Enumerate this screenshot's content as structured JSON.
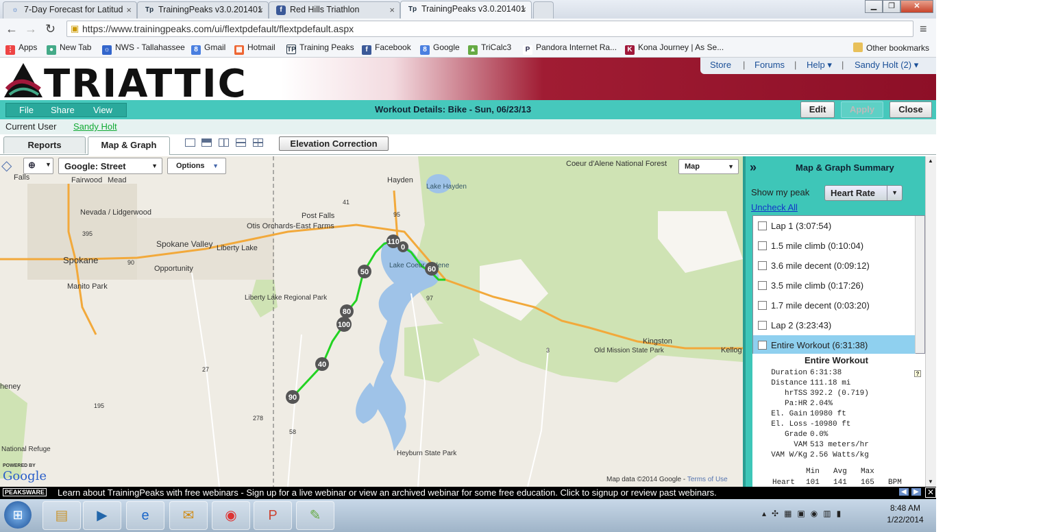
{
  "browser": {
    "tabs": [
      {
        "label": "7-Day Forecast for Latitud",
        "icon": "weather-icon"
      },
      {
        "label": "TrainingPeaks v3.0.201401",
        "icon": "trainingpeaks-icon"
      },
      {
        "label": "Red Hills Triathlon",
        "icon": "facebook-icon"
      },
      {
        "label": "TrainingPeaks v3.0.201401",
        "icon": "trainingpeaks-icon"
      }
    ],
    "url": "https://www.trainingpeaks.com/ui/flextpdefault/flextpdefault.aspx",
    "bookmarks": [
      "Apps",
      "New Tab",
      "NWS - Tallahassee",
      "Gmail",
      "Hotmail",
      "Training Peaks",
      "Facebook",
      "Google",
      "TriCalc3",
      "Pandora Internet Ra...",
      "Kona Journey | As Se...",
      "Other bookmarks"
    ]
  },
  "header": {
    "logo": "TRIATTIC",
    "links": [
      "Store",
      "Forums",
      "Help ▾",
      "Sandy Holt  (2) ▾"
    ]
  },
  "toolbar": {
    "menu": [
      "File",
      "Share",
      "View"
    ],
    "title": "Workout Details: Bike - Sun, 06/23/13",
    "edit": "Edit",
    "apply": "Apply",
    "close": "Close"
  },
  "user": {
    "label": "Current User",
    "name": "Sandy Holt"
  },
  "views": {
    "reports": "Reports",
    "map_graph": "Map & Graph",
    "elevation": "Elevation Correction"
  },
  "map": {
    "source": "Google: Street",
    "options": "Options",
    "type": "Map",
    "labels": [
      "Falls",
      "Fairwood",
      "Mead",
      "Hayden",
      "Lake Hayden",
      "Coeur d'Alene National Forest",
      "Nevada / Lidgerwood",
      "Otis Orchards-East Farms",
      "Post Falls",
      "Spokane Valley",
      "Liberty Lake",
      "Spokane",
      "Opportunity",
      "Manito Park",
      "Lake Coeur d'Alene",
      "Liberty Lake Regional Park",
      "Kingston",
      "Old Mission State Park",
      "Kellog",
      "heney",
      "National Refuge",
      "Heyburn State Park"
    ],
    "routes": [
      "395",
      "90",
      "41",
      "95",
      "27",
      "97",
      "3",
      "195",
      "278",
      "58"
    ],
    "markers": [
      "110",
      "0",
      "60",
      "50",
      "80",
      "100",
      "40",
      "90"
    ],
    "attribution": "Map data ©2014  Google - ",
    "terms": "Terms of Use",
    "powered": "POWERED BY",
    "google": "Google"
  },
  "panel": {
    "title": "Map & Graph Summary",
    "peak_label": "Show my peak",
    "peak_value": "Heart Rate",
    "uncheck": "Uncheck All",
    "laps": [
      "Lap 1 (3:07:54)",
      "1.5 mile climb (0:10:04)",
      "3.6 mile decent (0:09:12)",
      "3.5 mile climb (0:17:26)",
      "1.7 mile decent (0:03:20)",
      "Lap 2 (3:23:43)",
      "Entire Workout (6:31:38)"
    ],
    "summary_title": "Entire Workout",
    "stats": [
      {
        "k": "Duration",
        "v": "6:31:38"
      },
      {
        "k": "Distance",
        "v": "111.18 mi"
      },
      {
        "k": "hrTSS",
        "v": "392.2 (0.719)"
      },
      {
        "k": "Pa:HR",
        "v": "2.04%"
      },
      {
        "k": "El. Gain",
        "v": "10980 ft"
      },
      {
        "k": "El. Loss",
        "v": "-10980 ft"
      },
      {
        "k": "Grade",
        "v": "0.0%"
      },
      {
        "k": "VAM",
        "v": "513 meters/hr"
      },
      {
        "k": "VAM W/Kg",
        "v": "2.56 Watts/kg"
      }
    ],
    "cols": [
      "Min",
      "Avg",
      "Max"
    ],
    "hr_row": {
      "k": "Heart Rate",
      "min": "101",
      "avg": "141",
      "max": "165",
      "unit": "BPM"
    }
  },
  "banner": {
    "brand": "PEAKSWARE",
    "text": "Learn about TrainingPeaks with free webinars - Sign up for a live webinar or view an archived webinar for some free education. Click to signup or review past webinars."
  },
  "taskbar": {
    "time": "8:48 AM",
    "date": "1/22/2014"
  }
}
